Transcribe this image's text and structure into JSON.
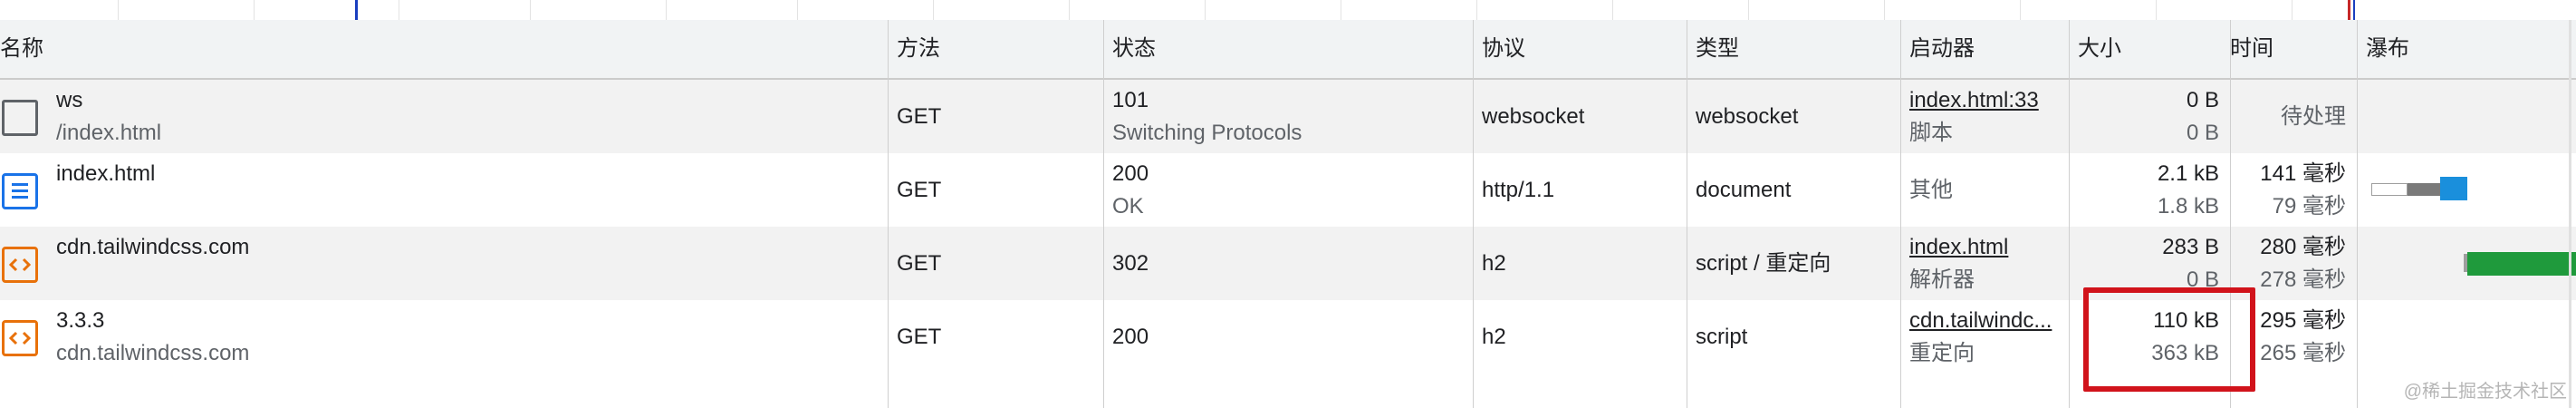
{
  "columns": {
    "name": "名称",
    "method": "方法",
    "status": "状态",
    "protocol": "协议",
    "type": "类型",
    "initiator": "启动器",
    "size": "大小",
    "time": "时间",
    "waterfall": "瀑布"
  },
  "rows": [
    {
      "name": "ws",
      "path": "/index.html",
      "icon": "websocket-icon",
      "method": "GET",
      "status_code": "101",
      "status_text": "Switching Protocols",
      "protocol": "websocket",
      "type": "websocket",
      "initiator": "index.html:33",
      "initiator_type": "脚本",
      "size_transferred": "0 B",
      "size_resource": "0 B",
      "time_total": "待处理",
      "time_latency": ""
    },
    {
      "name": "index.html",
      "path": "",
      "icon": "document-icon",
      "method": "GET",
      "status_code": "200",
      "status_text": "OK",
      "protocol": "http/1.1",
      "type": "document",
      "initiator": "其他",
      "initiator_type": "",
      "size_transferred": "2.1 kB",
      "size_resource": "1.8 kB",
      "time_total": "141 毫秒",
      "time_latency": "79 毫秒"
    },
    {
      "name": "cdn.tailwindcss.com",
      "path": "",
      "icon": "script-icon",
      "method": "GET",
      "status_code": "302",
      "status_text": "",
      "protocol": "h2",
      "type": "script / 重定向",
      "initiator": "index.html",
      "initiator_type": "解析器",
      "size_transferred": "283 B",
      "size_resource": "0 B",
      "time_total": "280 毫秒",
      "time_latency": "278 毫秒"
    },
    {
      "name": "3.3.3",
      "path": "cdn.tailwindcss.com",
      "icon": "script-icon",
      "method": "GET",
      "status_code": "200",
      "status_text": "",
      "protocol": "h2",
      "type": "script",
      "initiator": "cdn.tailwindc...",
      "initiator_type": "重定向",
      "size_transferred": "110 kB",
      "size_resource": "363 kB",
      "time_total": "295 毫秒",
      "time_latency": "265 毫秒"
    }
  ],
  "watermark": "@稀土掘金技术社区",
  "colors": {
    "highlight": "#d1131b",
    "header_bg": "#f1f3f4",
    "row_alt": "#f2f2f2",
    "doc_icon": "#1a73e8",
    "script_icon": "#e8710a",
    "ws_icon": "#5f6368",
    "wf_blue": "#1a8fdc",
    "wf_green": "#1f9a3c",
    "wf_gray": "#7a7a7a"
  }
}
